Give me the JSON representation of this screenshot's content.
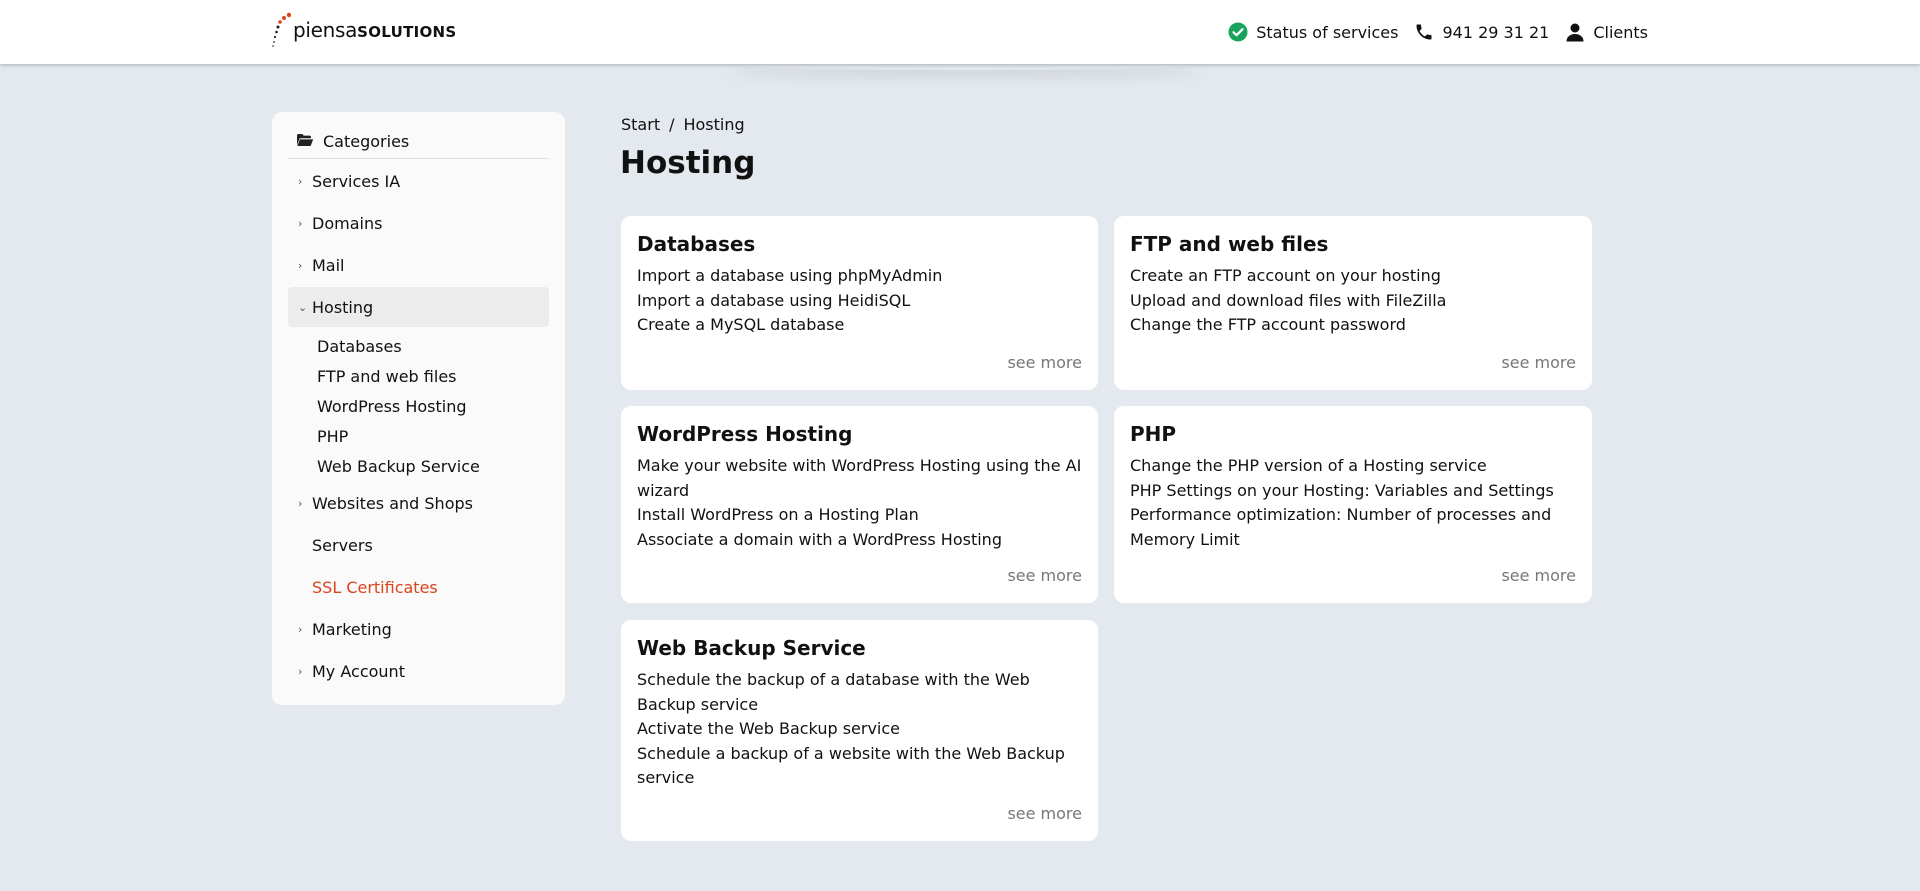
{
  "header": {
    "brand_light": "piensa",
    "brand_bold": "SOLUTIONS",
    "status_label": "Status of services",
    "phone": "941 29 31 21",
    "clients_label": "Clients",
    "status_color": "#1aa45b"
  },
  "sidebar": {
    "title": "Categories",
    "items": [
      {
        "label": "Services IA"
      },
      {
        "label": "Domains"
      },
      {
        "label": "Mail"
      },
      {
        "label": "Hosting"
      },
      {
        "label": "Websites and Shops"
      },
      {
        "label": "Servers"
      },
      {
        "label": "SSL Certificates"
      },
      {
        "label": "Marketing"
      },
      {
        "label": "My Account"
      }
    ],
    "subitems": [
      {
        "label": "Databases"
      },
      {
        "label": "FTP and web files"
      },
      {
        "label": "WordPress Hosting"
      },
      {
        "label": "PHP"
      },
      {
        "label": "Web Backup Service"
      }
    ],
    "accent_color": "#d9441c"
  },
  "breadcrumb": {
    "start": "Start",
    "separator": "/",
    "current": "Hosting"
  },
  "page_title": "Hosting",
  "see_more_label": "see more",
  "cards": [
    {
      "title": "Databases",
      "links": [
        "Import a database using phpMyAdmin",
        "Import a database using HeidiSQL",
        "Create a MySQL database"
      ]
    },
    {
      "title": "FTP and web files",
      "links": [
        "Create an FTP account on your hosting",
        "Upload and download files with FileZilla",
        "Change the FTP account password"
      ]
    },
    {
      "title": "WordPress Hosting",
      "links": [
        "Make your website with WordPress Hosting using the AI wizard",
        "Install WordPress on a Hosting Plan",
        "Associate a domain with a WordPress Hosting"
      ]
    },
    {
      "title": "PHP",
      "links": [
        "Change the PHP version of a Hosting service",
        "PHP Settings on your Hosting: Variables and Settings",
        "Performance optimization: Number of processes and Memory Limit"
      ]
    },
    {
      "title": "Web Backup Service",
      "links": [
        "Schedule the backup of a database with the Web Backup service",
        "Activate the Web Backup service",
        "Schedule a backup of a website with the Web Backup service"
      ]
    }
  ]
}
